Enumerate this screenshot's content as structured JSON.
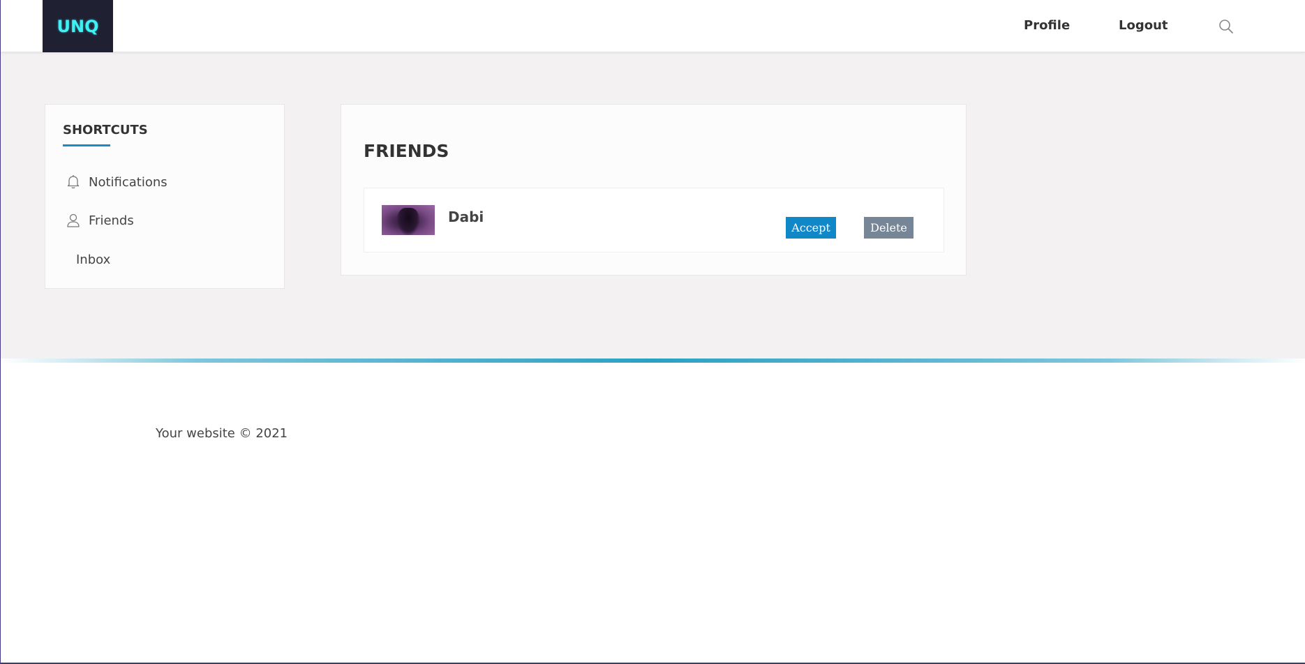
{
  "header": {
    "logo_text": "UNQ",
    "nav": {
      "profile": "Profile",
      "logout": "Logout"
    },
    "search_icon": "search-icon"
  },
  "sidebar": {
    "title": "SHORTCUTS",
    "accent_color": "#1a8ac6",
    "items": [
      {
        "label": "Notifications",
        "icon": "bell-icon"
      },
      {
        "label": "Friends",
        "icon": "user-icon"
      },
      {
        "label": "Inbox",
        "icon": ""
      }
    ]
  },
  "friends": {
    "title": "FRIENDS",
    "requests": [
      {
        "name": "Dabi",
        "accept_label": "Accept",
        "delete_label": "Delete"
      }
    ]
  },
  "colors": {
    "accept": "#1088c8",
    "delete": "#778696",
    "logo_bg": "#1f2133",
    "logo_text": "#3ff0f5"
  },
  "footer": {
    "text": "Your website © 2021"
  }
}
